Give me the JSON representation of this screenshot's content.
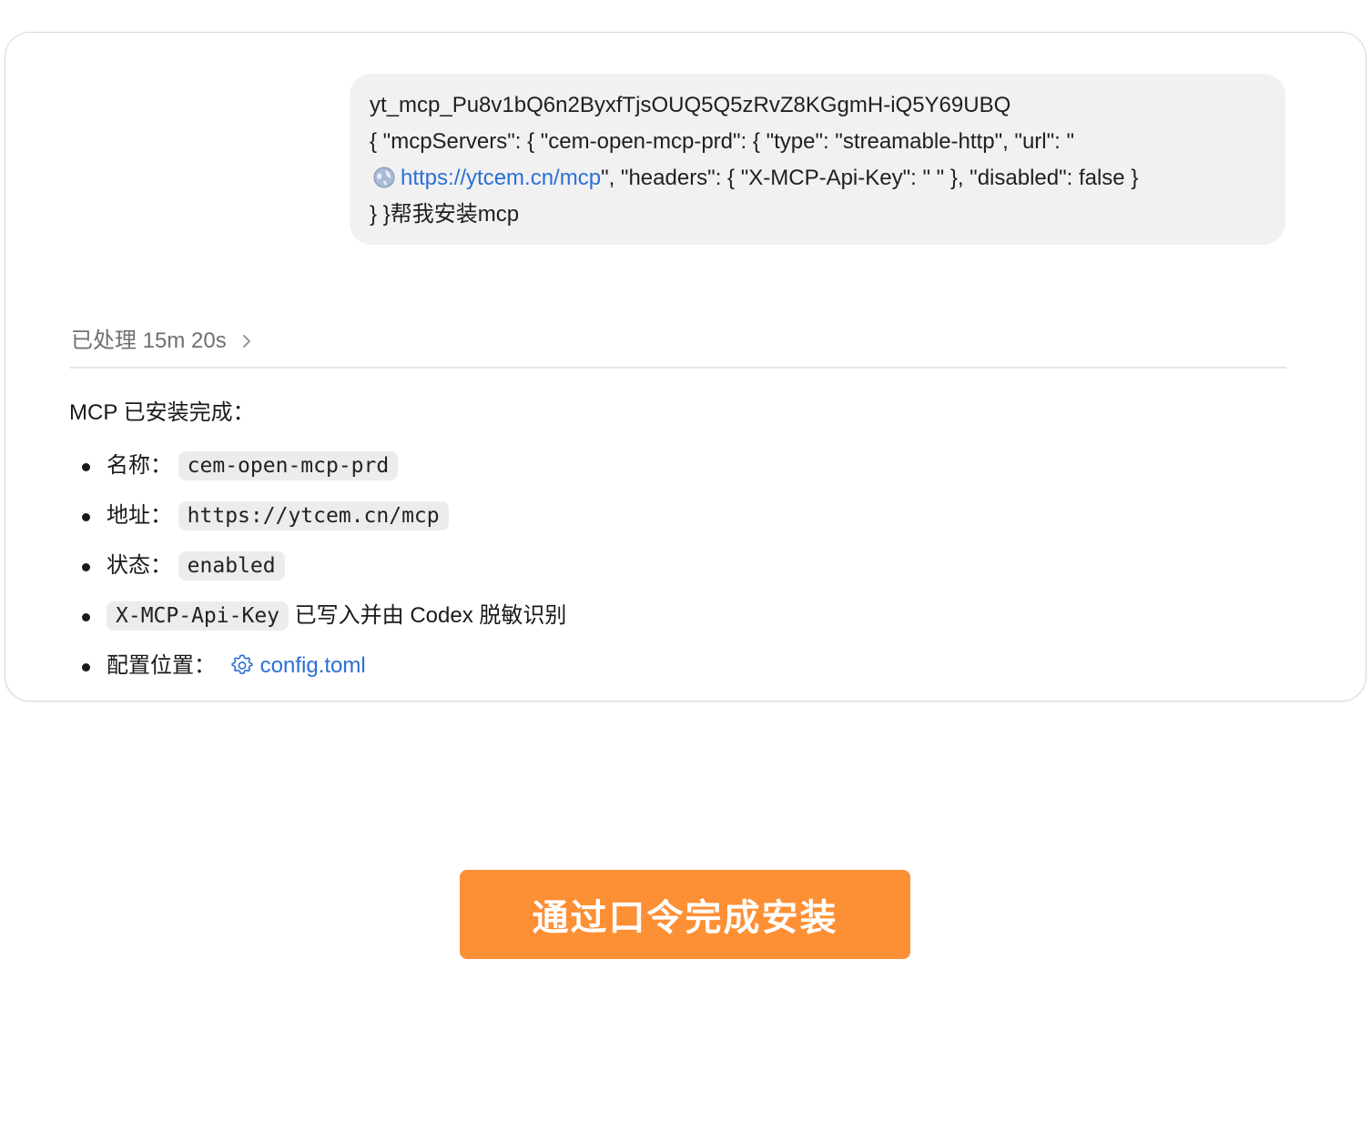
{
  "user_message": {
    "line1": "yt_mcp_Pu8v1bQ6n2ByxfTjsOUQ5Q5zRvZ8KGgmH-iQ5Y69UBQ",
    "line2": "{ \"mcpServers\": { \"cem-open-mcp-prd\": { \"type\": \"streamable-http\", \"url\": \"",
    "line3_link": "https://ytcem.cn/mcp",
    "line3_rest": "\", \"headers\": { \"X-MCP-Api-Key\": \" \" }, \"disabled\": false }",
    "line4": "} }帮我安装mcp",
    "link_icon": "globe-icon"
  },
  "processing": {
    "label": "已处理 15m 20s",
    "expand_icon": "chevron-right-icon"
  },
  "response": {
    "heading": "MCP 已安装完成：",
    "items": [
      {
        "label": "名称：",
        "code": "cem-open-mcp-prd"
      },
      {
        "label": "地址：",
        "code": "https://ytcem.cn/mcp"
      },
      {
        "label": "状态：",
        "code": "enabled"
      },
      {
        "code": "X-MCP-Api-Key",
        "text": " 已写入并由 Codex 脱敏识别"
      },
      {
        "label": "配置位置：",
        "link": "config.toml",
        "link_icon": "gear-icon"
      }
    ]
  },
  "cta": {
    "label": "通过口令完成安装"
  },
  "colors": {
    "accent_button": "#fd8f35",
    "link": "#2b6fd6",
    "bubble_bg": "#f1f1f1",
    "code_bg": "#ececec"
  }
}
